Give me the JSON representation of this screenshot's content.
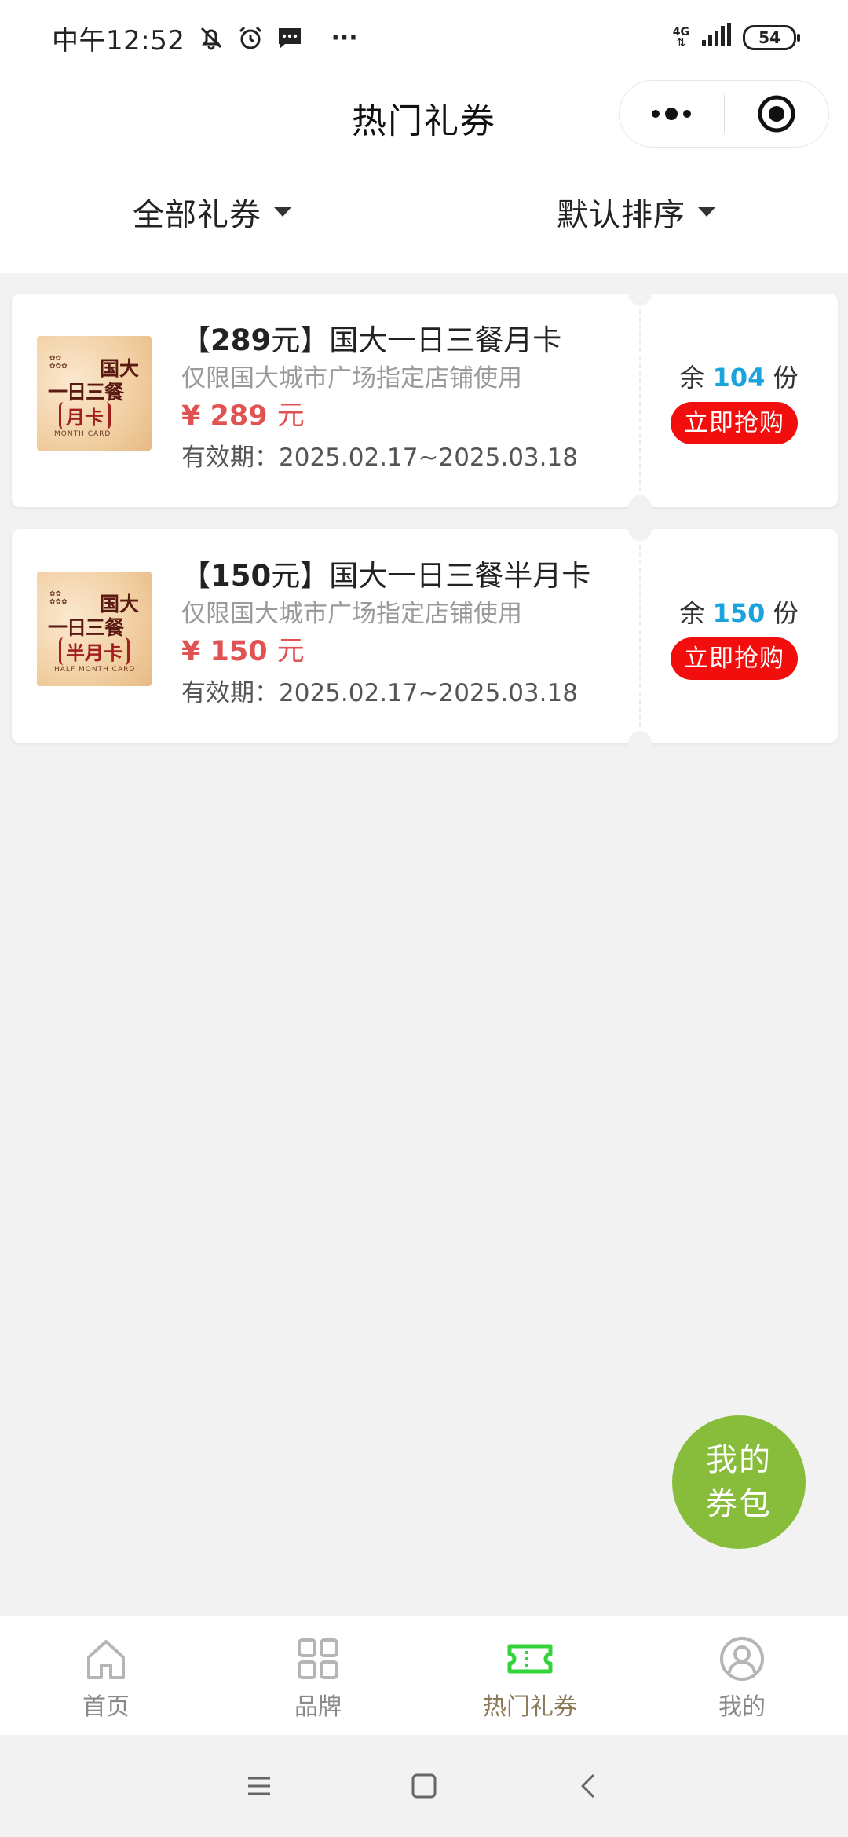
{
  "status_bar": {
    "time": "中午12:52",
    "network": "4G",
    "battery": "54",
    "more": "···"
  },
  "nav": {
    "title": "热门礼券"
  },
  "filters": {
    "category": "全部礼券",
    "sort": "默认排序"
  },
  "coupons": [
    {
      "title_bracket_open": "【",
      "title_amount": "289",
      "title_unit": "元",
      "title_bracket_close": "】",
      "title_rest": "国大一日三餐月卡",
      "description": "仅限国大城市广场指定店铺使用",
      "price_symbol": "¥",
      "price": "289",
      "price_unit": "元",
      "validity": "有效期：2025.02.17~2025.03.18",
      "remain_prefix": "余",
      "remain": "104",
      "remain_suffix": "份",
      "buy_label": "立即抢购",
      "image": {
        "line1": "国大",
        "line2": "一日三餐",
        "line3": "月卡",
        "english": "MONTH CARD"
      }
    },
    {
      "title_bracket_open": "【",
      "title_amount": "150",
      "title_unit": "元",
      "title_bracket_close": "】",
      "title_rest": "国大一日三餐半月卡",
      "description": "仅限国大城市广场指定店铺使用",
      "price_symbol": "¥",
      "price": "150",
      "price_unit": "元",
      "validity": "有效期：2025.02.17~2025.03.18",
      "remain_prefix": "余",
      "remain": "150",
      "remain_suffix": "份",
      "buy_label": "立即抢购",
      "image": {
        "line1": "国大",
        "line2": "一日三餐",
        "line3": "半月卡",
        "english": "HALF MONTH CARD"
      }
    }
  ],
  "wallet": {
    "line1": "我的",
    "line2": "券包"
  },
  "tabs": [
    {
      "label": "首页",
      "icon": "home-icon",
      "active": false
    },
    {
      "label": "品牌",
      "icon": "grid-icon",
      "active": false
    },
    {
      "label": "热门礼券",
      "icon": "ticket-icon",
      "active": true
    },
    {
      "label": "我的",
      "icon": "user-icon",
      "active": false
    }
  ],
  "colors": {
    "accent_green": "#33d43a",
    "wallet_green": "#87bd3a",
    "price_red": "#e15252",
    "buy_red": "#f30e0e",
    "remain_blue": "#1aa3dd",
    "tab_active_text": "#8b7a57"
  }
}
